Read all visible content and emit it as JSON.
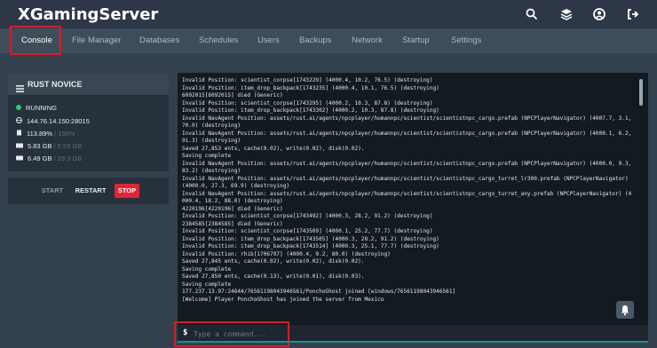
{
  "app": {
    "brand": "XGamingServer"
  },
  "top_icons": [
    {
      "name": "search-icon"
    },
    {
      "name": "layers-icon"
    },
    {
      "name": "account-icon"
    },
    {
      "name": "logout-icon"
    }
  ],
  "tabs": [
    {
      "label": "Console",
      "active": true
    },
    {
      "label": "File Manager"
    },
    {
      "label": "Databases"
    },
    {
      "label": "Schedules"
    },
    {
      "label": "Users"
    },
    {
      "label": "Backups"
    },
    {
      "label": "Network"
    },
    {
      "label": "Startup"
    },
    {
      "label": "Settings"
    }
  ],
  "server": {
    "name": "RUST NOVICE",
    "status": "RUNNING",
    "address": "144.76.14.150:28015",
    "cpu": "113.89%",
    "cpu_limit": "/ 150%",
    "memory": "5.83 GB",
    "memory_limit": "/ 5.59 GB",
    "disk": "6.49 GB",
    "disk_limit": "/ 29.3 GB"
  },
  "controls": {
    "start": "START",
    "restart": "RESTART",
    "stop": "STOP"
  },
  "console": {
    "lines": [
      "Invalid Position: scientist_corpse[1743229] (4000.4, 10.2, 76.5) (destroying)",
      "Invalid Position: item_drop_backpack[1743235] (4000.4, 10.1, 76.5) (destroying)",
      "6092015[6092015] died (Generic)",
      "Invalid Position: scientist_corpse[1743295] (4000.2, 10.3, 87.8) (destroying)",
      "Invalid Position: item_drop_backpack[1743302] (4000.2, 10.3, 87.8) (destroying)",
      "Invalid NavAgent Position: assets/rust.ai/agents/npcplayer/humannpc/scientist/scientistnpc_cargo.prefab (NPCPlayerNavigator) (4007.7, 3.1, 70.0) (destroying)",
      "Invalid NavAgent Position: assets/rust.ai/agents/npcplayer/humannpc/scientist/scientistnpc_cargo.prefab (NPCPlayerNavigator) (4000.1, 6.2, 91.3) (destroying)",
      "Saved 27,853 ents, cache(0.02), write(0.02), disk(0.02).",
      "Saving complete",
      "Invalid NavAgent Position: assets/rust.ai/agents/npcplayer/humannpc/scientist/scientistnpc_cargo.prefab (NPCPlayerNavigator) (4000.0, 9.3, 83.2) (destroying)",
      "Invalid NavAgent Position: assets/rust.ai/agents/npcplayer/humannpc/scientist/scientistnpc_cargo_turret_lr300.prefab (NPCPlayerNavigator) (4000.0, 27.3, 69.9) (destroying)",
      "Invalid NavAgent Position: assets/rust.ai/agents/npcplayer/humannpc/scientist/scientistnpc_cargo_turret_any.prefab (NPCPlayerNavigator) (4000.4, 18.2, 88.0) (destroying)",
      "4220196[4220196] died (Generic)",
      "Invalid Position: scientist_corpse[1743492] (4000.3, 28.2, 91.2) (destroying)",
      "2384585[2384585] died (Generic)",
      "Invalid Position: scientist_corpse[1743509] (4000.1, 25.2, 77.7) (destroying)",
      "Invalid Position: item_drop_backpack[1743505] (4000.3, 28.2, 91.2) (destroying)",
      "Invalid Position: item_drop_backpack[1743514] (4000.3, 25.1, 77.7) (destroying)",
      "Invalid Position: rhib[1706797] (4000.4, 9.2, 80.0) (destroying)",
      "Saved 27,845 ents, cache(0.02), write(0.02), disk(0.02).",
      "Saving complete",
      "Saved 27,850 ents, cache(0.13), write(0.01), disk(0.03).",
      "Saving complete",
      "177.237.13.97:24644/76561198043946561/PonchoGhost joined [windows/76561198043946561]",
      "[Welcome] Player PonchoGhost has joined the server from Mexico"
    ],
    "prompt": "$",
    "placeholder": "Type a command..."
  },
  "colors": {
    "accent_red": "#d11f2b",
    "running_green": "#2ecc71",
    "stop_red": "#e02636"
  }
}
